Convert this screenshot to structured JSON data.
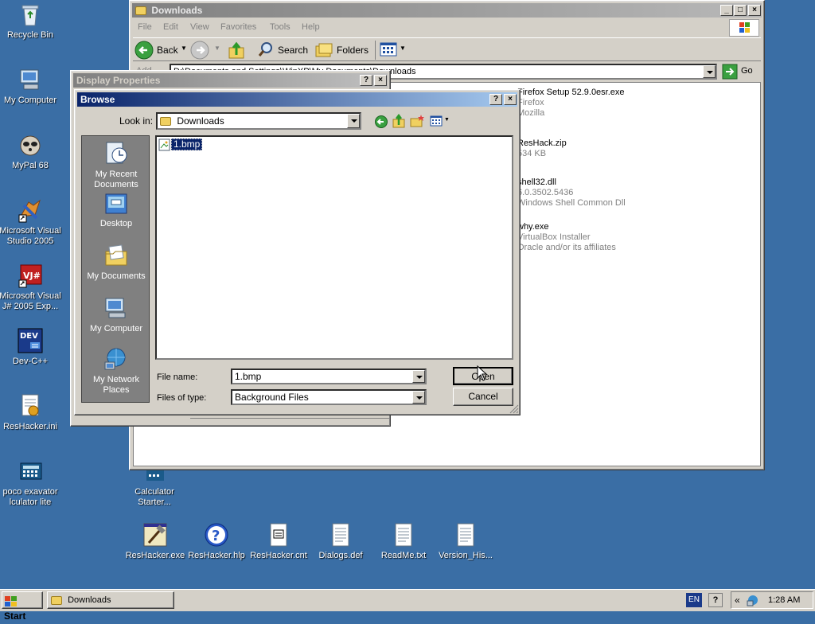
{
  "desktop": {
    "left_icons": [
      {
        "name": "recycle-bin-icon",
        "label": "Recycle Bin"
      },
      {
        "name": "my-computer-icon",
        "label": "My Computer"
      },
      {
        "name": "mypal-icon",
        "label": "MyPal 68"
      },
      {
        "name": "visual-studio-icon",
        "label": "Microsoft Visual Studio 2005"
      },
      {
        "name": "visual-jsharp-icon",
        "label": "Microsoft Visual J# 2005 Exp..."
      },
      {
        "name": "dev-cpp-icon",
        "label": "Dev-C++"
      },
      {
        "name": "reshacker-ini-icon",
        "label": "ResHacker.ini"
      },
      {
        "name": "calculator-icon",
        "label": "poco exavator lculator lite"
      }
    ],
    "calc_starter": "Calculator Starter...",
    "bottom_icons": [
      {
        "name": "reshacker-exe-icon",
        "label": "ResHacker.exe"
      },
      {
        "name": "help-file-icon",
        "label": "ResHacker.hlp"
      },
      {
        "name": "cnt-file-icon",
        "label": "ResHacker.cnt"
      },
      {
        "name": "def-file-icon",
        "label": "Dialogs.def"
      },
      {
        "name": "txt-file-icon",
        "label": "ReadMe.txt"
      },
      {
        "name": "txt-file-icon-2",
        "label": "Version_His..."
      }
    ]
  },
  "explorer": {
    "title": "Downloads",
    "menu": [
      "File",
      "Edit",
      "View",
      "Favorites",
      "Tools",
      "Help"
    ],
    "toolbar": {
      "back": "Back",
      "search": "Search",
      "folders": "Folders"
    },
    "address_label": "Add",
    "address_value": "D:\\Documents and Settings\\WinXP\\My Documents\\Downloads",
    "go": "Go",
    "files": [
      {
        "name": "Firefox Setup 52.9.0esr.exe",
        "line2": "Firefox",
        "line3": "Mozilla"
      },
      {
        "name": "ResHack.zip",
        "line2": "534 KB",
        "line3": ""
      },
      {
        "name": "shell32.dll",
        "line2": "6.0.3502.5436",
        "line3": "Windows Shell Common Dll"
      },
      {
        "name": "why.exe",
        "line2": "VirtualBox Installer",
        "line3": "Oracle and/or its affiliates"
      }
    ]
  },
  "display_properties": {
    "title": "Display Properties"
  },
  "browse": {
    "title": "Browse",
    "look_in_label": "Look in:",
    "look_in_value": "Downloads",
    "places": [
      {
        "name": "places-recent",
        "label": "My Recent Documents"
      },
      {
        "name": "places-desktop",
        "label": "Desktop"
      },
      {
        "name": "places-documents",
        "label": "My Documents"
      },
      {
        "name": "places-computer",
        "label": "My Computer"
      },
      {
        "name": "places-network",
        "label": "My Network Places"
      }
    ],
    "file_item": "1.bmp",
    "file_name_label": "File name:",
    "file_name_value": "1.bmp",
    "file_type_label": "Files of type:",
    "file_type_value": "Background Files",
    "open_label": "Open",
    "cancel_label": "Cancel"
  },
  "taskbar": {
    "start": "Start",
    "task": "Downloads",
    "lang": "EN",
    "clock": "1:28 AM"
  }
}
